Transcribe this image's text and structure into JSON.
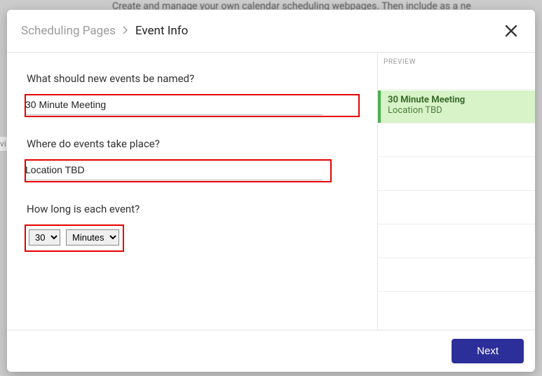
{
  "background": {
    "top_text": "Create and manage your own calendar scheduling webpages. Then include as a ne",
    "side_tag": "vi"
  },
  "header": {
    "breadcrumb_prev": "Scheduling Pages",
    "breadcrumb_current": "Event Info"
  },
  "form": {
    "name_label": "What should new events be named?",
    "name_value": "30 Minute Meeting",
    "location_label": "Where do events take place?",
    "location_value": "Location TBD",
    "duration_label": "How long is each event?",
    "duration_number": "30",
    "duration_unit": "Minutes"
  },
  "preview": {
    "label": "PREVIEW",
    "event_title": "30 Minute Meeting",
    "event_location": "Location TBD"
  },
  "footer": {
    "next_label": "Next"
  }
}
